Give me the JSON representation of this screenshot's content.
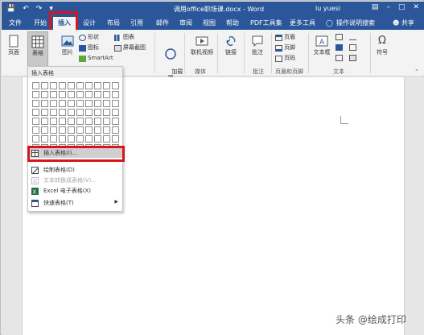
{
  "title_bar": {
    "document_title": "调用office职场课.docx - Word",
    "user": "lu yuesi",
    "quick_access": [
      "save-icon",
      "undo-icon",
      "redo-icon"
    ],
    "window_controls": [
      "ribbon-display-icon",
      "minimize-icon",
      "maximize-icon",
      "close-icon"
    ]
  },
  "tabs": [
    "文件",
    "开始",
    "插入",
    "设计",
    "布局",
    "引用",
    "邮件",
    "审阅",
    "视图",
    "帮助",
    "PDF工具集",
    "更多工具"
  ],
  "active_tab": "插入",
  "tell_me": "操作说明搜索",
  "share": "共享",
  "ribbon": {
    "pages_label": "页面",
    "table_label": "表格",
    "pictures_label": "图片",
    "shapes_label": "形状",
    "icons_label": "图标",
    "smartart_label": "SmartArt",
    "chart_label": "图表",
    "screenshot_label": "屏幕截图",
    "addins_label": "加载\n项",
    "online_video_label": "联机视频",
    "link_label": "链接",
    "comment_label": "批注",
    "header_label": "页眉",
    "footer_label": "页脚",
    "page_number_label": "页码",
    "textbox_label": "文本框",
    "symbol_label": "符号",
    "group_media": "媒体",
    "group_comments": "批注",
    "group_header_footer": "页眉和页脚",
    "group_text": "文本"
  },
  "dropdown": {
    "header": "插入表格",
    "grid_cols": 10,
    "grid_rows": 8,
    "items": [
      {
        "label": "插入表格(I)...",
        "icon": "insert-table-icon",
        "disabled": false,
        "hover": true
      },
      {
        "label": "绘制表格(D)",
        "icon": "draw-table-icon",
        "disabled": false
      },
      {
        "label": "文本转换成表格(V)...",
        "icon": "text-to-table-icon",
        "disabled": true
      },
      {
        "label": "Excel 电子表格(X)",
        "icon": "excel-icon",
        "disabled": false
      },
      {
        "label": "快速表格(T)",
        "icon": "quick-table-icon",
        "disabled": false,
        "submenu": true
      }
    ]
  },
  "watermark": "头条 @绘成打印",
  "colors": {
    "title_bar": "#2b579a",
    "ribbon_bg": "#f3f3f3",
    "highlight_box": "#d9151b"
  }
}
